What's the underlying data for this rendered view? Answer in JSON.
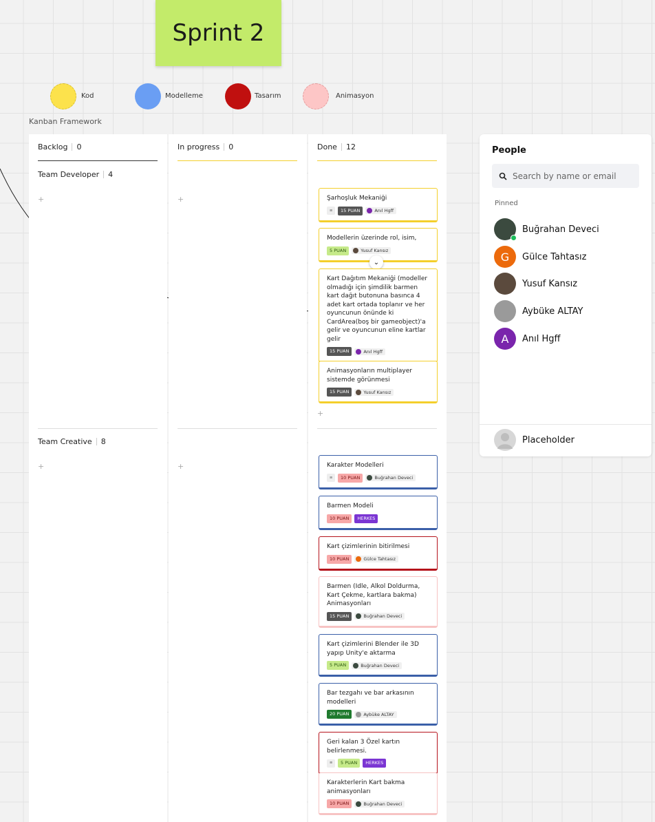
{
  "sticky": {
    "text": "Sprint 2",
    "color": "#c3eb6a"
  },
  "legend": [
    {
      "label": "Kod",
      "color": "#fce24c"
    },
    {
      "label": "Modelleme",
      "color": "#6a9ef3"
    },
    {
      "label": "Tasarım",
      "color": "#c0100f"
    },
    {
      "label": "Animasyon",
      "color": "#fdc6c6"
    }
  ],
  "frame_title": "Kanban Framework",
  "columns": [
    {
      "name": "Backlog",
      "count": "0"
    },
    {
      "name": "In progress",
      "count": "0"
    },
    {
      "name": "Done",
      "count": "12"
    }
  ],
  "swimlanes": [
    {
      "name": "Team Developer",
      "count": "4"
    },
    {
      "name": "Team Creative",
      "count": "8"
    }
  ],
  "plus_symbol": "+",
  "done_cards_developer": [
    {
      "title": "Şarhoşluk Mekaniği",
      "points": "15 PUAN",
      "assignee": "Anıl Hgff",
      "border": "#f4cf2b"
    },
    {
      "title": "Modellerin üzerinde rol, isim,",
      "points": "5 PUAN",
      "assignee": "Yusuf Kansız",
      "border": "#f4cf2b"
    },
    {
      "title": "Kart Dağıtım Mekaniği (modeller olmadığı için şimdilik barmen kart dağıt butonuna basınca 4 adet kart ortada toplanır ve her oyuncunun önünde ki CardArea(boş bir gameobject)'a gelir ve oyuncunun eline kartlar gelir",
      "points": "15 PUAN",
      "assignee": "Anıl Hgff",
      "border": "#f4cf2b"
    },
    {
      "title": "Animasyonların multiplayer sistemde görünmesi",
      "points": "15 PUAN",
      "assignee": "Yusuf Kansız",
      "border": "#f4cf2b"
    }
  ],
  "done_cards_creative": [
    {
      "title": "Karakter Modelleri",
      "points": "10 PUAN",
      "assignee": "Buğrahan Deveci",
      "border": "#3a5fa8"
    },
    {
      "title": "Barmen Modeli",
      "points": "10 PUAN",
      "assignee": "HERKES",
      "border": "#3a5fa8"
    },
    {
      "title": "Kart çizimlerinin bitirilmesi",
      "points": "10 PUAN",
      "assignee": "Gülce Tahtasız",
      "border": "#b5121b"
    },
    {
      "title": "Barmen (Idle, Alkol Doldurma, Kart Çekme, kartlara bakma) Animasyonları",
      "points": "15 PUAN",
      "assignee": "Buğrahan Deveci",
      "border": "#f7c3c3"
    },
    {
      "title": "Kart çizimlerini Blender ile 3D yapıp Unity'e aktarma",
      "points": "5 PUAN",
      "assignee": "Buğrahan Deveci",
      "border": "#3a5fa8"
    },
    {
      "title": "Bar tezgahı ve bar arkasının modelleri",
      "points": "20 PUAN",
      "assignee": "Aybüke ALTAY",
      "border": "#3a5fa8"
    },
    {
      "title": "Geri kalan 3 Özel kartın belirlenmesi.",
      "points": "5 PUAN",
      "assignee": "HERKES",
      "border": "#b5121b"
    },
    {
      "title": "Karakterlerin Kart bakma animasyonları",
      "points": "10 PUAN",
      "assignee": "Buğrahan Deveci",
      "border": "#f7c3c3"
    }
  ],
  "people_panel": {
    "title": "People",
    "search_placeholder": "Search by name or email",
    "pinned_label": "Pinned",
    "people": [
      {
        "name": "Buğrahan Deveci",
        "initial": "",
        "color": "#3b4a3f",
        "online": true
      },
      {
        "name": "Gülce Tahtasız",
        "initial": "G",
        "color": "#ec6a0c",
        "online": false
      },
      {
        "name": "Yusuf Kansız",
        "initial": "",
        "color": "#5b4a3d",
        "online": false
      },
      {
        "name": "Aybüke ALTAY",
        "initial": "",
        "color": "#9a9a9a",
        "online": false
      },
      {
        "name": "Anıl Hgff",
        "initial": "A",
        "color": "#7a25ac",
        "online": false
      }
    ],
    "placeholder_name": "Placeholder"
  }
}
